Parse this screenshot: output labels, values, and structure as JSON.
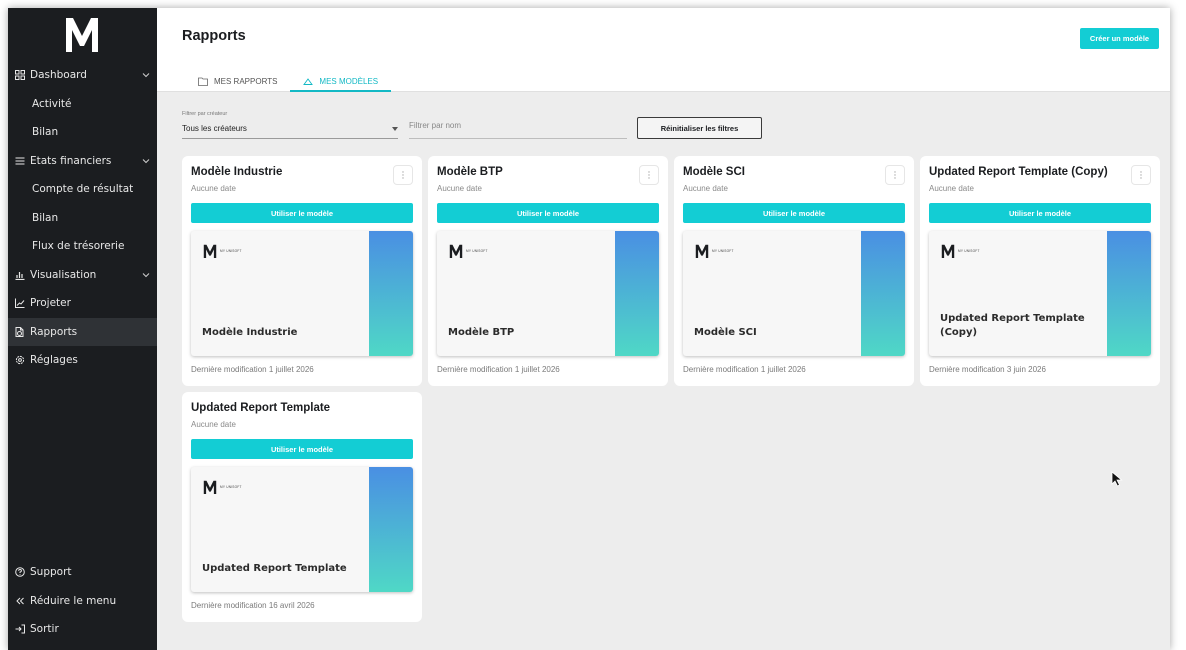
{
  "sidebar": {
    "items": [
      {
        "label": "Dashboard",
        "icon": "grid-icon",
        "sub": false,
        "chevron": true
      },
      {
        "label": "Activité",
        "sub": true
      },
      {
        "label": "Bilan",
        "sub": true
      },
      {
        "label": "Etats financiers",
        "icon": "menu-lines-icon",
        "sub": false,
        "chevron": true
      },
      {
        "label": "Compte de résultat",
        "sub": true
      },
      {
        "label": "Bilan",
        "sub": true
      },
      {
        "label": "Flux de trésorerie",
        "sub": true
      },
      {
        "label": "Visualisation",
        "icon": "bar-chart-icon",
        "sub": false,
        "chevron": true
      },
      {
        "label": "Projeter",
        "icon": "trend-chart-icon",
        "sub": false
      },
      {
        "label": "Rapports",
        "icon": "report-icon",
        "sub": false,
        "active": true
      },
      {
        "label": "Réglages",
        "icon": "gear-icon",
        "sub": false
      }
    ],
    "bottom": [
      {
        "label": "Support",
        "icon": "help-circle-icon"
      },
      {
        "label": "Réduire le menu",
        "icon": "double-chevron-left-icon"
      },
      {
        "label": "Sortir",
        "icon": "logout-icon"
      }
    ]
  },
  "header": {
    "title": "Rapports",
    "create_label": "Créer un modèle",
    "tabs": [
      {
        "label": "MES RAPPORTS",
        "icon": "folder-icon",
        "active": false
      },
      {
        "label": "MES MODÈLES",
        "icon": "cloud-icon",
        "active": true
      }
    ]
  },
  "filters": {
    "creator_label": "Filtrer par créateur",
    "creator_value": "Tous les créateurs",
    "name_placeholder": "Filtrer par nom",
    "reset_label": "Réinitialiser les filtres"
  },
  "cards": [
    {
      "title": "Modèle Industrie",
      "date": "Aucune date",
      "use_label": "Utiliser le modèle",
      "brand": "MY UNISOFT",
      "preview_title": "Modèle Industrie",
      "modified": "Dernière modification 1 juillet 2026"
    },
    {
      "title": "Modèle BTP",
      "date": "Aucune date",
      "use_label": "Utiliser le modèle",
      "brand": "MY UNISOFT",
      "preview_title": "Modèle BTP",
      "modified": "Dernière modification 1 juillet 2026"
    },
    {
      "title": "Modèle SCI",
      "date": "Aucune date",
      "use_label": "Utiliser le modèle",
      "brand": "MY UNISOFT",
      "preview_title": "Modèle SCI",
      "modified": "Dernière modification 1 juillet 2026"
    },
    {
      "title": "Updated Report Template (Copy)",
      "date": "Aucune date",
      "use_label": "Utiliser le modèle",
      "brand": "MY UNISOFT",
      "preview_title": "Updated Report Template (Copy)",
      "modified": "Dernière modification 3 juin 2026"
    },
    {
      "title": "Updated Report Template",
      "date": "Aucune date",
      "use_label": "Utiliser le modèle",
      "brand": "MY UNISOFT",
      "preview_title": "Updated Report Template",
      "modified": "Dernière modification 16 avril 2026"
    }
  ],
  "colors": {
    "accent": "#13cdd4",
    "sidebar_bg": "#1b1d20",
    "sidebar_active": "#2f3236",
    "tab_active": "#13b9c5",
    "gradient_top": "#4a8fe3",
    "gradient_bottom": "#4fd8c6"
  }
}
